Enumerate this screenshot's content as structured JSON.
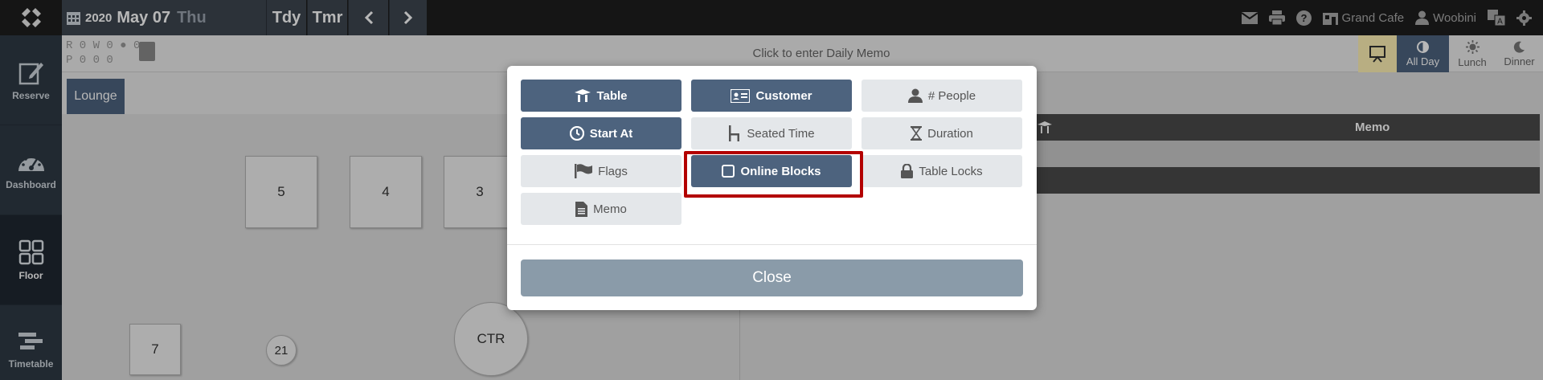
{
  "topbar": {
    "year": "2020",
    "month_day": "May 07",
    "weekday": "Thu",
    "today_label": "Tdy",
    "tomorrow_label": "Tmr",
    "restaurant": "Grand Cafe",
    "user": "Woobini"
  },
  "sidebar": {
    "items": [
      {
        "label": "Reserve",
        "icon": "edit-icon"
      },
      {
        "label": "Dashboard",
        "icon": "gauge-icon"
      },
      {
        "label": "Floor",
        "icon": "grid-icon"
      },
      {
        "label": "Timetable",
        "icon": "timetable-icon"
      }
    ]
  },
  "infostrip": {
    "r_row": "R 0 W 0 ● 0",
    "p_row": "P 0   0   0",
    "daily_memo": "Click to enter Daily Memo",
    "slots": {
      "all_day": "All Day",
      "lunch": "Lunch",
      "dinner": "Dinner"
    }
  },
  "floor": {
    "tab": "Lounge",
    "tables": [
      "5",
      "4",
      "3",
      "7",
      "21",
      "CTR"
    ]
  },
  "list": {
    "memo_header": "Memo"
  },
  "modal": {
    "options": {
      "table": "Table",
      "customer": "Customer",
      "people": "# People",
      "start_at": "Start At",
      "seated_time": "Seated Time",
      "duration": "Duration",
      "flags": "Flags",
      "online_blocks": "Online Blocks",
      "table_locks": "Table Locks",
      "memo": "Memo"
    },
    "close_label": "Close"
  }
}
